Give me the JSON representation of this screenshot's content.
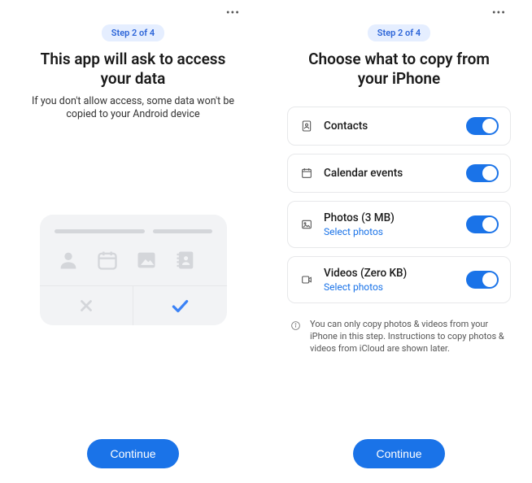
{
  "left": {
    "step": "Step 2 of 4",
    "title": "This app will ask to access your data",
    "subtitle": "If you don't allow access, some data won't be copied to your Android device",
    "continue": "Continue"
  },
  "right": {
    "step": "Step 2 of 4",
    "title": "Choose what to copy from your iPhone",
    "items": [
      {
        "label": "Contacts",
        "on": true
      },
      {
        "label": "Calendar events",
        "on": true
      },
      {
        "label": "Photos (3 MB)",
        "link": "Select photos",
        "on": true
      },
      {
        "label": "Videos (Zero KB)",
        "link": "Select photos",
        "on": true
      }
    ],
    "info": "You can only copy photos & videos from your iPhone in this step. Instructions to copy photos & videos from iCloud are shown later.",
    "continue": "Continue"
  }
}
